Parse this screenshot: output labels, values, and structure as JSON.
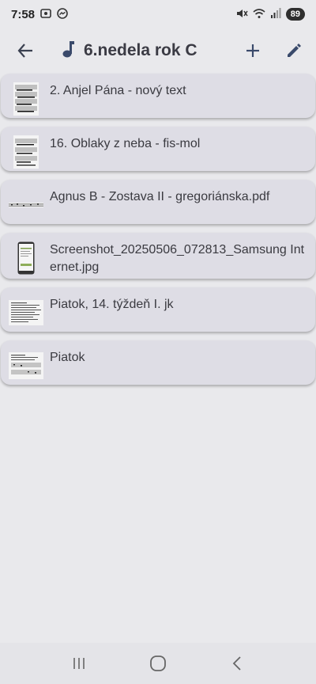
{
  "status_bar": {
    "time": "7:58",
    "battery": "89",
    "left_icons": [
      "screenshot-icon",
      "messenger-icon"
    ],
    "right_icons": [
      "mute-icon",
      "wifi-icon",
      "signal-icon"
    ]
  },
  "app_bar": {
    "title": "6.nedela rok C",
    "title_icon": "music-note-icon",
    "back_icon": "back-arrow-icon",
    "add_icon": "plus-icon",
    "edit_icon": "pencil-icon"
  },
  "items": [
    {
      "title": "2. Anjel Pána - nový text",
      "thumb": "sheet-music"
    },
    {
      "title": "16. Oblaky z neba - fis-mol",
      "thumb": "sheet-music"
    },
    {
      "title": "Agnus B - Zostava II - gregoriánska.pdf",
      "thumb": "chant-strip"
    },
    {
      "title": "Screenshot_20250506_072813_Samsung Internet.jpg",
      "thumb": "phone-screenshot"
    },
    {
      "title": "Piatok, 14. týždeň I. jk",
      "thumb": "text-document"
    },
    {
      "title": "Piatok",
      "thumb": "text-document-music"
    }
  ],
  "nav_bar": {
    "recents_icon": "recents-icon",
    "home_icon": "home-icon",
    "back_icon": "nav-back-icon"
  },
  "colors": {
    "background": "#e9e9ec",
    "card": "#dedde5",
    "title": "#3b3b44",
    "icon": "#3a4a6b"
  }
}
